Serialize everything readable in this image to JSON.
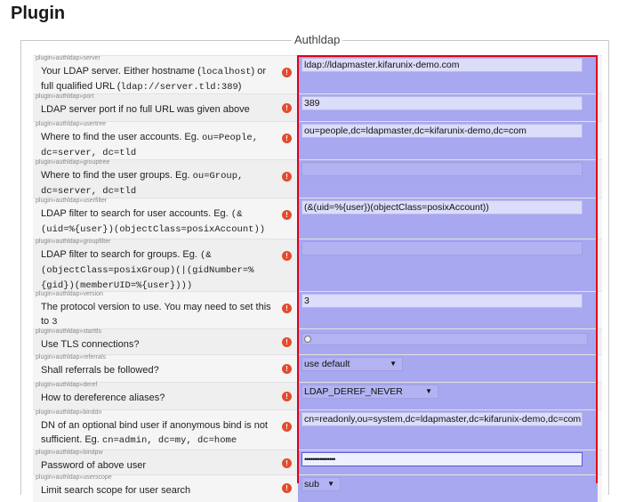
{
  "page": {
    "title": "Plugin"
  },
  "section": {
    "legend": "Authldap"
  },
  "settings": [
    {
      "key": "plugin»authldap»server",
      "desc": [
        "Your LDAP server. Either hostname (",
        {
          "code": "localhost"
        },
        ") or full qualified URL (",
        {
          "code": "ldap://server.tld:389"
        },
        ")"
      ],
      "control": "text",
      "value": "ldap://ldapmaster.kifarunix-demo.com"
    },
    {
      "key": "plugin»authldap»port",
      "desc": [
        "LDAP server port if no full URL was given above"
      ],
      "control": "text",
      "value": "389"
    },
    {
      "key": "plugin»authldap»usertree",
      "desc": [
        "Where to find the user accounts. Eg. ",
        {
          "code": "ou=People, dc=server, dc=tld"
        }
      ],
      "control": "text",
      "value": "ou=people,dc=ldapmaster,dc=kifarunix-demo,dc=com"
    },
    {
      "key": "plugin»authldap»grouptree",
      "desc": [
        "Where to find the user groups. Eg. ",
        {
          "code": "ou=Group, dc=server, dc=tld"
        }
      ],
      "control": "text",
      "value": ""
    },
    {
      "key": "plugin»authldap»userfilter",
      "desc": [
        "LDAP filter to search for user accounts. Eg. ",
        {
          "code": "(&(uid=%{user})(objectClass=posixAccount))"
        }
      ],
      "control": "text",
      "value": "(&(uid=%{user})(objectClass=posixAccount))"
    },
    {
      "key": "plugin»authldap»groupfilter",
      "desc": [
        "LDAP filter to search for groups. Eg. ",
        {
          "code": "(&(objectClass=posixGroup)(|(gidNumber=%{gid})(memberUID=%{user})))"
        }
      ],
      "control": "text",
      "value": ""
    },
    {
      "key": "plugin»authldap»version",
      "desc": [
        "The protocol version to use. You may need to set this to ",
        {
          "code": "3"
        }
      ],
      "control": "text",
      "value": "3"
    },
    {
      "key": "plugin»authldap»starttls",
      "desc": [
        "Use TLS connections?"
      ],
      "control": "checkbox",
      "value": ""
    },
    {
      "key": "plugin»authldap»referrals",
      "desc": [
        "Shall referrals be followed?"
      ],
      "control": "select",
      "value": "use default"
    },
    {
      "key": "plugin»authldap»deref",
      "desc": [
        "How to dereference aliases?"
      ],
      "control": "select",
      "value": "LDAP_DEREF_NEVER"
    },
    {
      "key": "plugin»authldap»binddn",
      "desc": [
        "DN of an optional bind user if anonymous bind is not sufficient. Eg. ",
        {
          "code": "cn=admin, dc=my, dc=home"
        }
      ],
      "control": "text",
      "value": "cn=readonly,ou=system,dc=ldapmaster,dc=kifarunix-demo,dc=com"
    },
    {
      "key": "plugin»authldap»bindpw",
      "desc": [
        "Password of above user"
      ],
      "control": "password",
      "value": "••••••••••••••••"
    },
    {
      "key": "plugin»authldap»userscope",
      "desc": [
        "Limit search scope for user search"
      ],
      "control": "select",
      "value": "sub"
    }
  ],
  "icons": {
    "info": "warning-circle-icon",
    "info_glyph": "!"
  },
  "colors": {
    "highlight": "#e0001a",
    "field_bg": "#a8a8f0"
  }
}
